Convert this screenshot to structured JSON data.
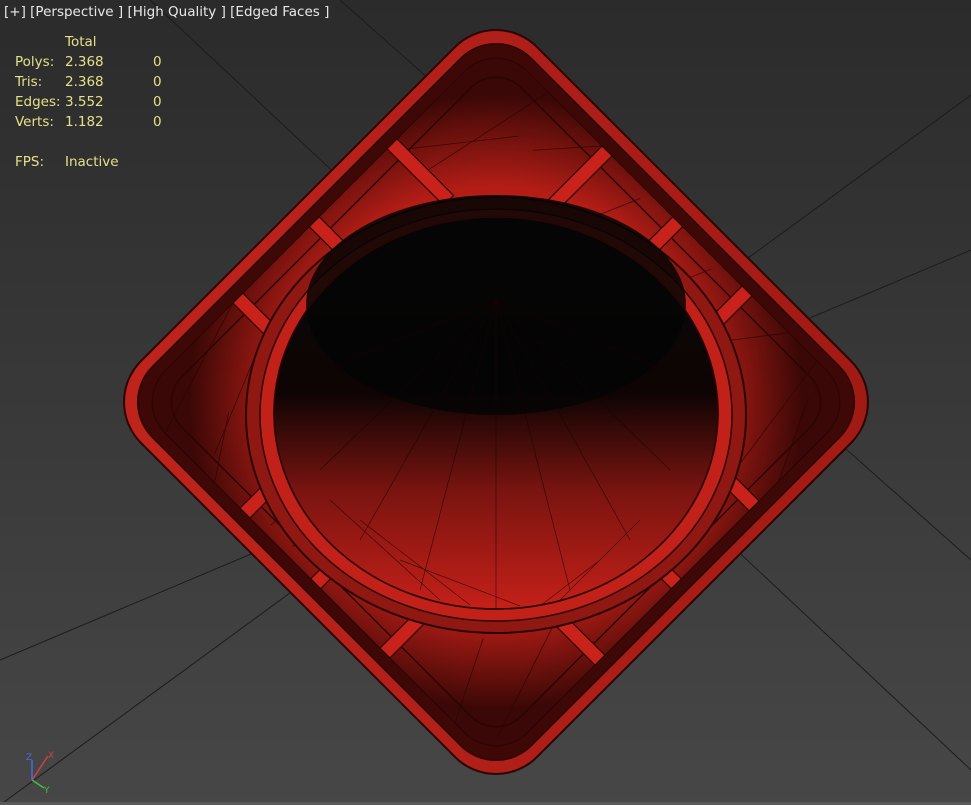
{
  "viewport": {
    "label_items": [
      "[+]",
      "[Perspective ]",
      "[High Quality ]",
      "[Edged Faces ]"
    ]
  },
  "stats": {
    "header": "Total",
    "rows": [
      {
        "label": "Polys:",
        "total": "2.368",
        "selected": "0"
      },
      {
        "label": "Tris:",
        "total": "2.368",
        "selected": "0"
      },
      {
        "label": "Edges:",
        "total": "3.552",
        "selected": "0"
      },
      {
        "label": "Verts:",
        "total": "1.182",
        "selected": "0"
      }
    ],
    "fps_label": "FPS:",
    "fps_value": "Inactive"
  },
  "axis_gizmo": {
    "x_color": "#d04040",
    "y_color": "#3fbf3f",
    "z_color": "#4a6adf",
    "x_label": "X",
    "y_label": "Y",
    "z_label": "Z"
  },
  "colors": {
    "mesh_red": "#c8221b",
    "mesh_dark": "#5a0c08",
    "wire": "#2a0504",
    "stats_text": "#e5e08a",
    "label_text": "#e9e9e9"
  }
}
